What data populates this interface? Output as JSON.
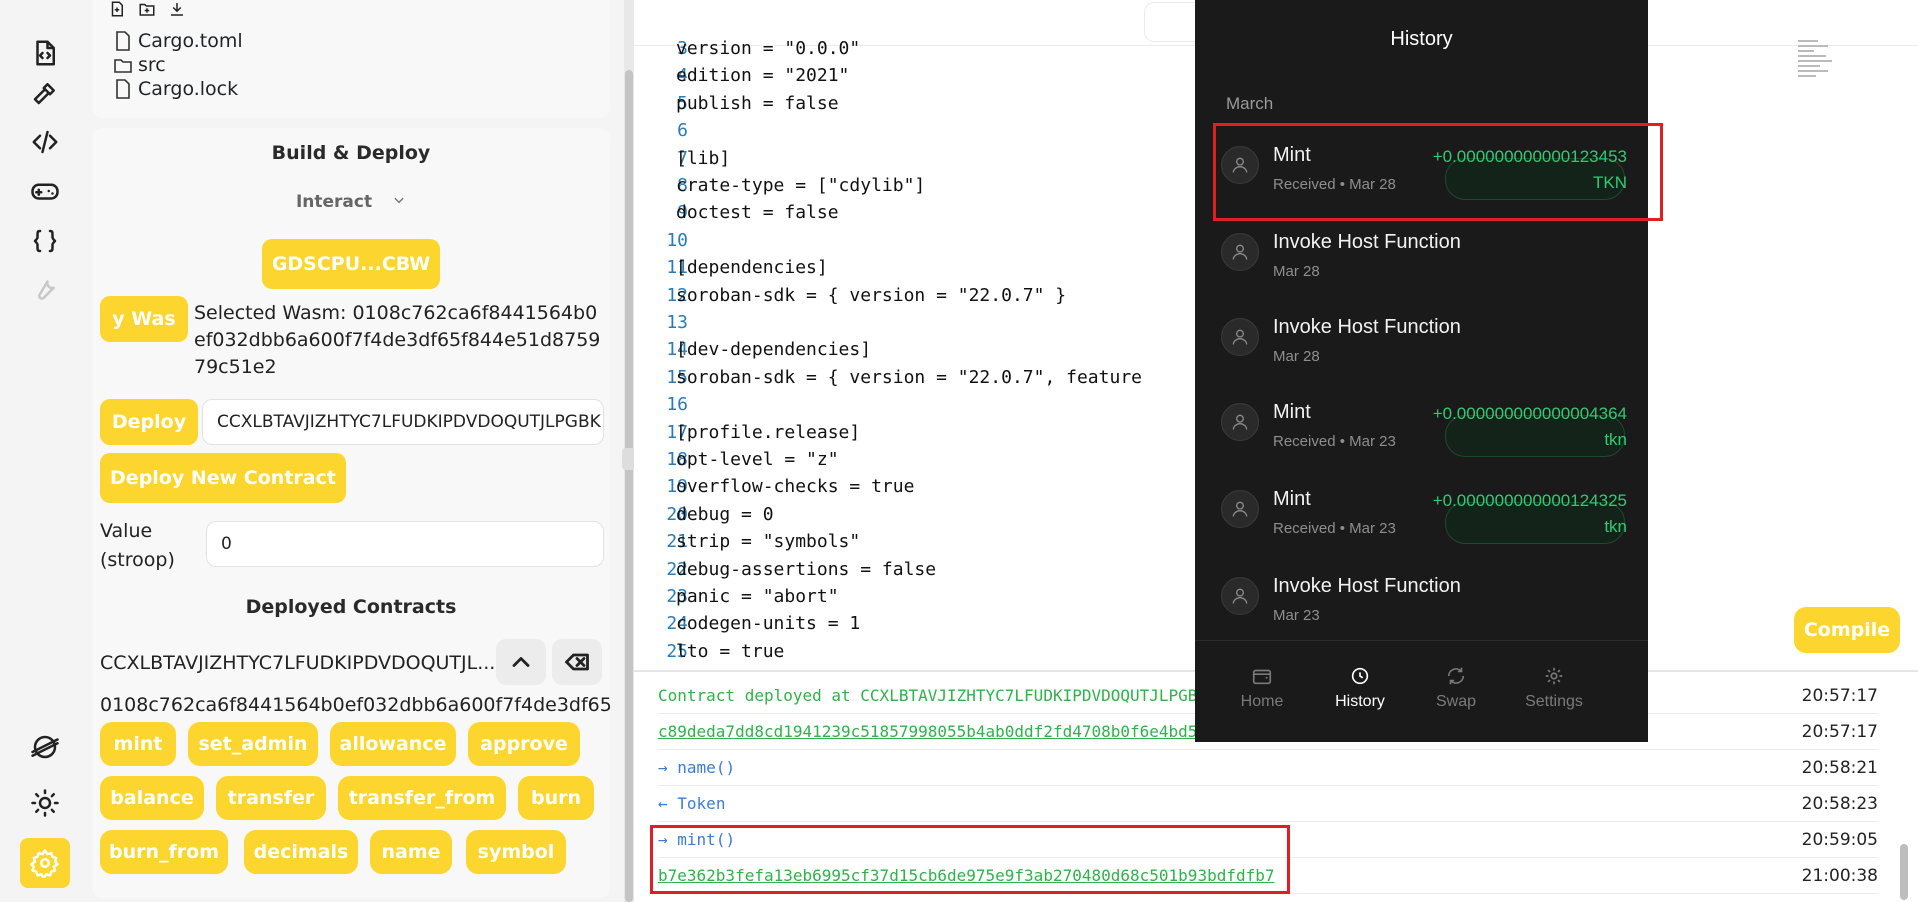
{
  "files": {
    "items": [
      "Cargo.toml",
      "src",
      "Cargo.lock"
    ]
  },
  "build": {
    "title": "Build & Deploy",
    "mode_label": "Interact",
    "account_button": "GDSCPU...CBW",
    "wasm_button": "y Was",
    "selected_wasm": "Selected Wasm: 0108c762ca6f8441564b0ef032dbb6a600f7f4de3df65f844e51d875979c51e2",
    "deploy_button": "Deploy",
    "deploy_input": "CCXLBTAVJIZHTYC7LFUDKIPDVDOQUTJLPGBK",
    "deploy_new_button": "Deploy New Contract",
    "value_label": "Value (stroop)",
    "value_input": "0",
    "deployed_title": "Deployed Contracts",
    "contract_id": "CCXLBTAVJIZHTYC7LFUDKIPDVDOQUTJL...",
    "contract_hash": "0108c762ca6f8441564b0ef032dbb6a600f7f4de3df65",
    "methods": [
      "mint",
      "set_admin",
      "allowance",
      "approve",
      "balance",
      "transfer",
      "transfer_from",
      "burn",
      "burn_from",
      "decimals",
      "name",
      "symbol"
    ]
  },
  "editor": {
    "lines": [
      {
        "n": "3",
        "t": "version = \"0.0.0\""
      },
      {
        "n": "4",
        "t": "edition = \"2021\""
      },
      {
        "n": "5",
        "t": "publish = false"
      },
      {
        "n": "6",
        "t": ""
      },
      {
        "n": "7",
        "t": "[lib]"
      },
      {
        "n": "8",
        "t": "crate-type = [\"cdylib\"]"
      },
      {
        "n": "9",
        "t": "doctest = false"
      },
      {
        "n": "10",
        "t": ""
      },
      {
        "n": "11",
        "t": "[dependencies]"
      },
      {
        "n": "12",
        "t": "soroban-sdk = { version = \"22.0.7\" }"
      },
      {
        "n": "13",
        "t": ""
      },
      {
        "n": "14",
        "t": "[dev-dependencies]"
      },
      {
        "n": "15",
        "t": "soroban-sdk = { version = \"22.0.7\", feature"
      },
      {
        "n": "16",
        "t": ""
      },
      {
        "n": "17",
        "t": "[profile.release]"
      },
      {
        "n": "18",
        "t": "opt-level = \"z\""
      },
      {
        "n": "19",
        "t": "overflow-checks = true"
      },
      {
        "n": "20",
        "t": "debug = 0"
      },
      {
        "n": "21",
        "t": "strip = \"symbols\""
      },
      {
        "n": "22",
        "t": "debug-assertions = false"
      },
      {
        "n": "23",
        "t": "panic = \"abort\""
      },
      {
        "n": "24",
        "t": "codegen-units = 1"
      },
      {
        "n": "25",
        "t": "lto = true"
      }
    ],
    "compile_button": "Compile"
  },
  "console": {
    "rows": [
      {
        "kind": "green",
        "prefix": "",
        "text": "Contract deployed at CCXLBTAVJIZHTYC7LFUDKIPDVDOQUTJLPGB",
        "time": "20:57:17"
      },
      {
        "kind": "link",
        "prefix": "",
        "text": "c89deda7dd8cd1941239c51857998055b4ab0ddf2fd4708b0f6e4bd5",
        "time": "20:57:17"
      },
      {
        "kind": "blue",
        "prefix": "→",
        "text": "name()",
        "time": "20:58:21"
      },
      {
        "kind": "blue",
        "prefix": "←",
        "text": "Token",
        "time": "20:58:23"
      },
      {
        "kind": "blue",
        "prefix": "→",
        "text": "mint()",
        "time": "20:59:05"
      },
      {
        "kind": "link",
        "prefix": "",
        "text": "b7e362b3fefa13eb6995cf37d15cb6de975e9f3ab270480d68c501b93bdfdfb7",
        "time": "21:00:38"
      }
    ]
  },
  "wallet": {
    "title": "History",
    "month": "March",
    "transactions": [
      {
        "name": "Mint",
        "sub": "Received • Mar 28",
        "amount": "+0.000000000000123453",
        "unit": "TKN"
      },
      {
        "name": "Invoke Host Function",
        "sub": "Mar 28",
        "amount": "",
        "unit": ""
      },
      {
        "name": "Invoke Host Function",
        "sub": "Mar 28",
        "amount": "",
        "unit": ""
      },
      {
        "name": "Mint",
        "sub": "Received • Mar 23",
        "amount": "+0.000000000000004364",
        "unit": "tkn"
      },
      {
        "name": "Mint",
        "sub": "Received • Mar 23",
        "amount": "+0.000000000000124325",
        "unit": "tkn"
      },
      {
        "name": "Invoke Host Function",
        "sub": "Mar 23",
        "amount": "",
        "unit": ""
      }
    ],
    "nav": [
      "Home",
      "History",
      "Swap",
      "Settings"
    ]
  },
  "colors": {
    "accent": "#fcd52e",
    "highlight": "#e02020",
    "success": "#2ecc71"
  }
}
